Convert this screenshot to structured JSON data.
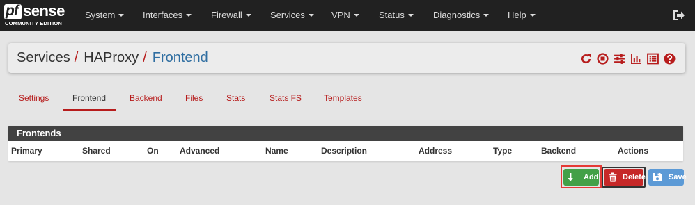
{
  "brand": {
    "prefix": "pf",
    "name": "sense",
    "edition": "COMMUNITY EDITION"
  },
  "nav": [
    {
      "label": "System"
    },
    {
      "label": "Interfaces"
    },
    {
      "label": "Firewall"
    },
    {
      "label": "Services"
    },
    {
      "label": "VPN"
    },
    {
      "label": "Status"
    },
    {
      "label": "Diagnostics"
    },
    {
      "label": "Help"
    }
  ],
  "breadcrumb": {
    "items": [
      "Services",
      "HAProxy",
      "Frontend"
    ],
    "separator": "/"
  },
  "breadcrumb_icons": [
    "refresh-icon",
    "stop-icon",
    "settings-sliders-icon",
    "chart-icon",
    "list-icon",
    "help-icon"
  ],
  "tabs": [
    {
      "label": "Settings",
      "active": false
    },
    {
      "label": "Frontend",
      "active": true
    },
    {
      "label": "Backend",
      "active": false
    },
    {
      "label": "Files",
      "active": false
    },
    {
      "label": "Stats",
      "active": false
    },
    {
      "label": "Stats FS",
      "active": false
    },
    {
      "label": "Templates",
      "active": false
    }
  ],
  "panel": {
    "title": "Frontends",
    "columns": [
      "Primary",
      "Shared",
      "On",
      "Advanced",
      "Name",
      "Description",
      "Address",
      "Type",
      "Backend",
      "Actions"
    ],
    "rows": []
  },
  "buttons": {
    "add": "Add",
    "delete": "Delete",
    "save": "Save"
  },
  "colors": {
    "accent": "#b71c1c",
    "navbar": "#212121",
    "link": "#2f6ea1",
    "add": "#43a047",
    "delete": "#c62828",
    "save": "#5c9ad6",
    "panel_head": "#424242"
  }
}
